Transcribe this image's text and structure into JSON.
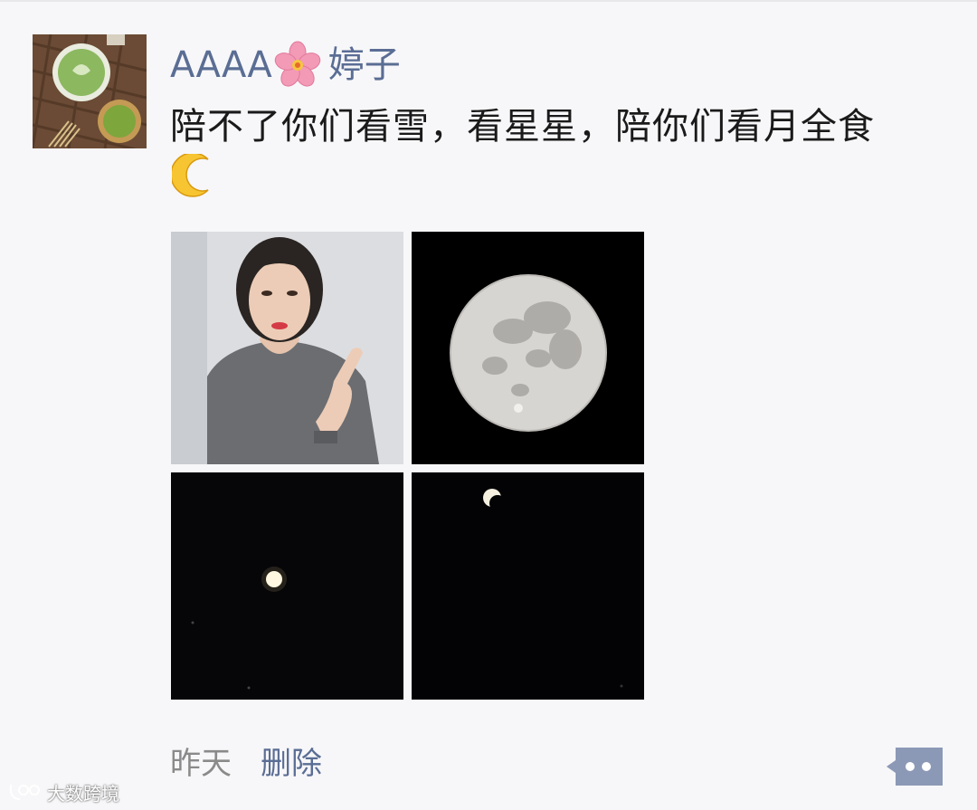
{
  "post": {
    "author_name": "AAAA",
    "author_nickname": "婷子",
    "text": "陪不了你们看雪，看星星，陪你们看月全食",
    "emoji_icon": "crescent-moon-emoji",
    "name_icon": "cherry-blossom-emoji",
    "photos": [
      {
        "icon": "selfie-photo"
      },
      {
        "icon": "full-moon-photo"
      },
      {
        "icon": "night-moon-photo"
      },
      {
        "icon": "eclipse-moon-photo"
      }
    ],
    "timestamp": "昨天",
    "delete_label": "删除",
    "more_icon": "comment-more-icon"
  },
  "watermark": {
    "text": "大数跨境"
  },
  "colors": {
    "background": "#f7f7f9",
    "name_color": "#5a6d94",
    "text_color": "#1a1a1a",
    "muted_color": "#8a8a8a",
    "more_button": "#8c99b6"
  }
}
